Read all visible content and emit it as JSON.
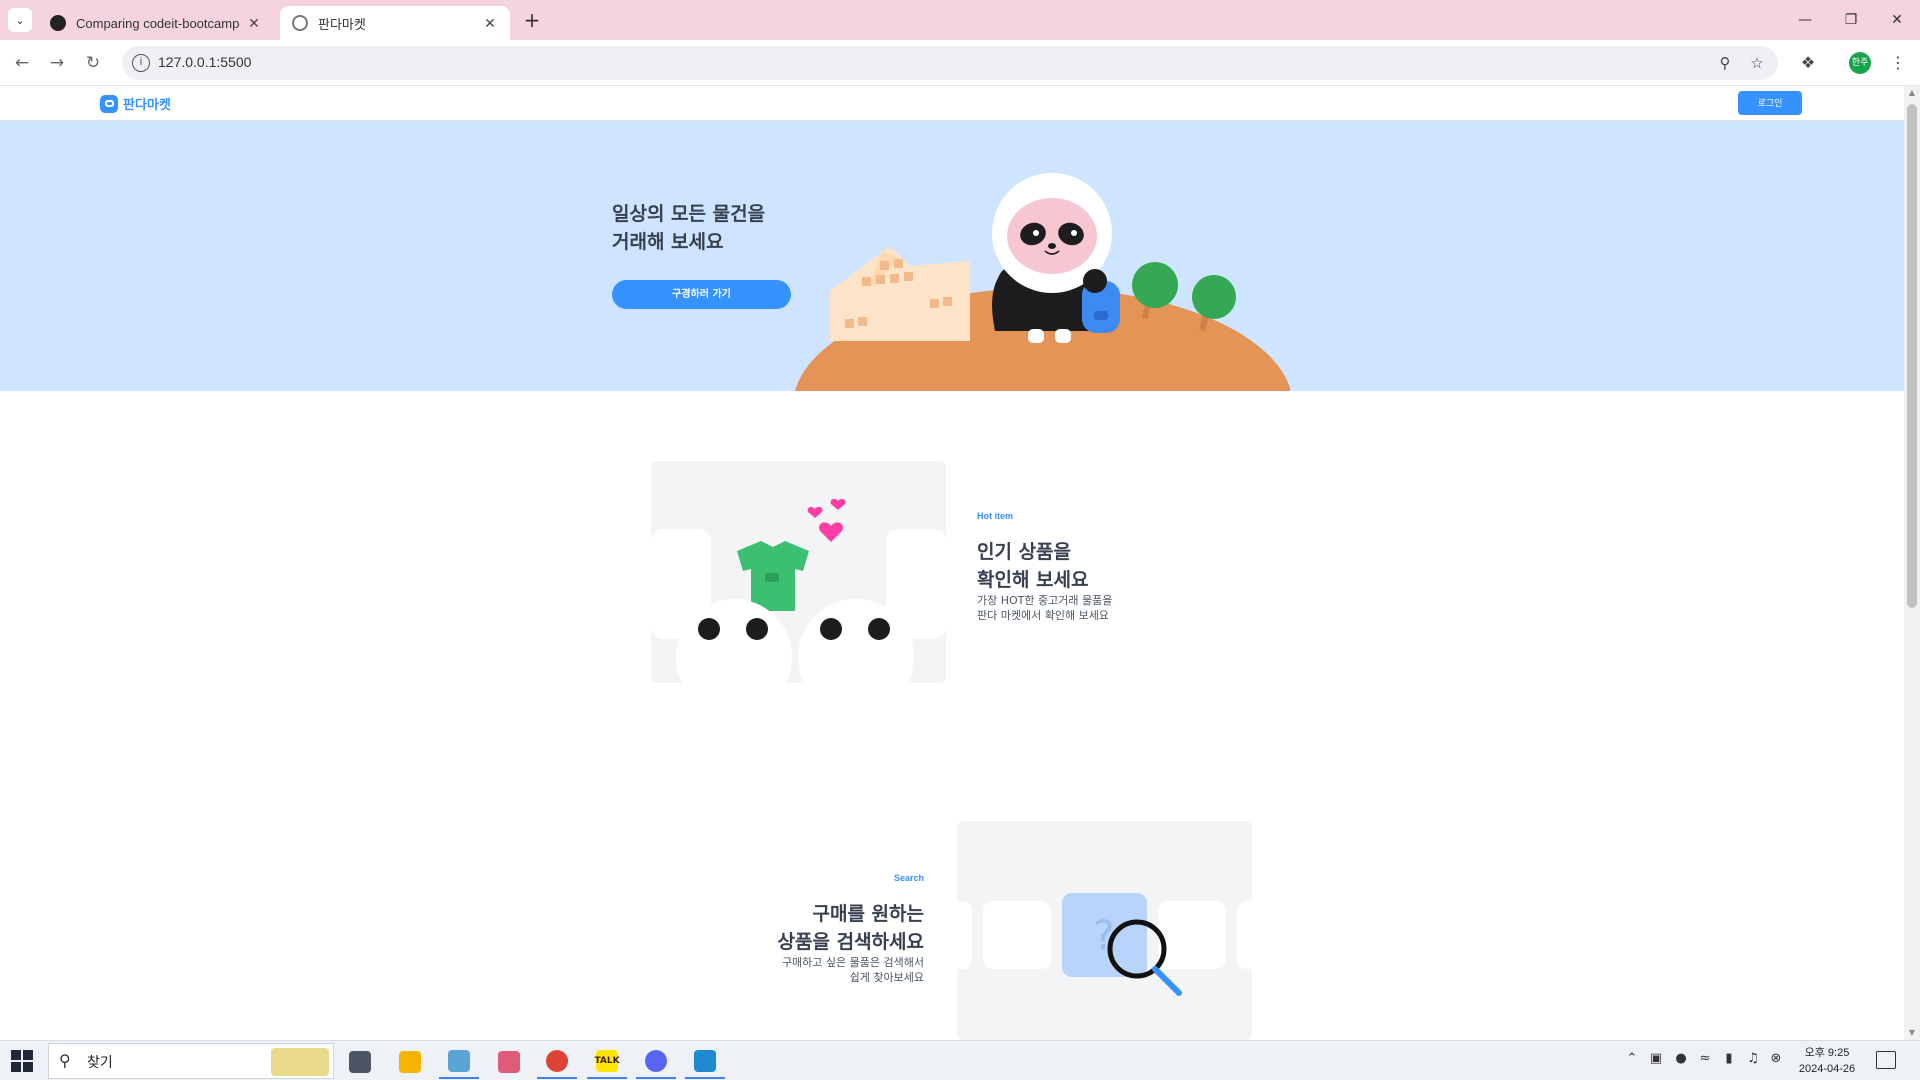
{
  "browser": {
    "tabs": [
      {
        "title": "Comparing codeit-bootcamp-f"
      },
      {
        "title": "판다마켓"
      }
    ],
    "url": "127.0.0.1:5500"
  },
  "site": {
    "logo_text": "판다마켓",
    "login_label": "로그인",
    "hero": {
      "title": "일상의 모든 물건을\n거래해 보세요",
      "button": "구경하러 가기"
    },
    "features": [
      {
        "tag": "Hot item",
        "title": "인기 상품을\n확인해 보세요",
        "desc": "가장 HOT한 중고거래 물품을\n판다 마켓에서 확인해 보세요"
      },
      {
        "tag": "Search",
        "title": "구매를 원하는\n상품을 검색하세요",
        "desc": "구매하고 싶은 물품은 검색해서\n쉽게 찾아보세요"
      }
    ]
  },
  "taskbar": {
    "search_placeholder": "찾기",
    "time_period": "오후 9:25",
    "date": "2024-04-26",
    "kakao_label": "TALK",
    "profile_initials": "한주"
  },
  "colors": {
    "brand": "#3692ff",
    "hero_bg": "#cfe5ff",
    "tabstrip": "#f6d3e1"
  }
}
